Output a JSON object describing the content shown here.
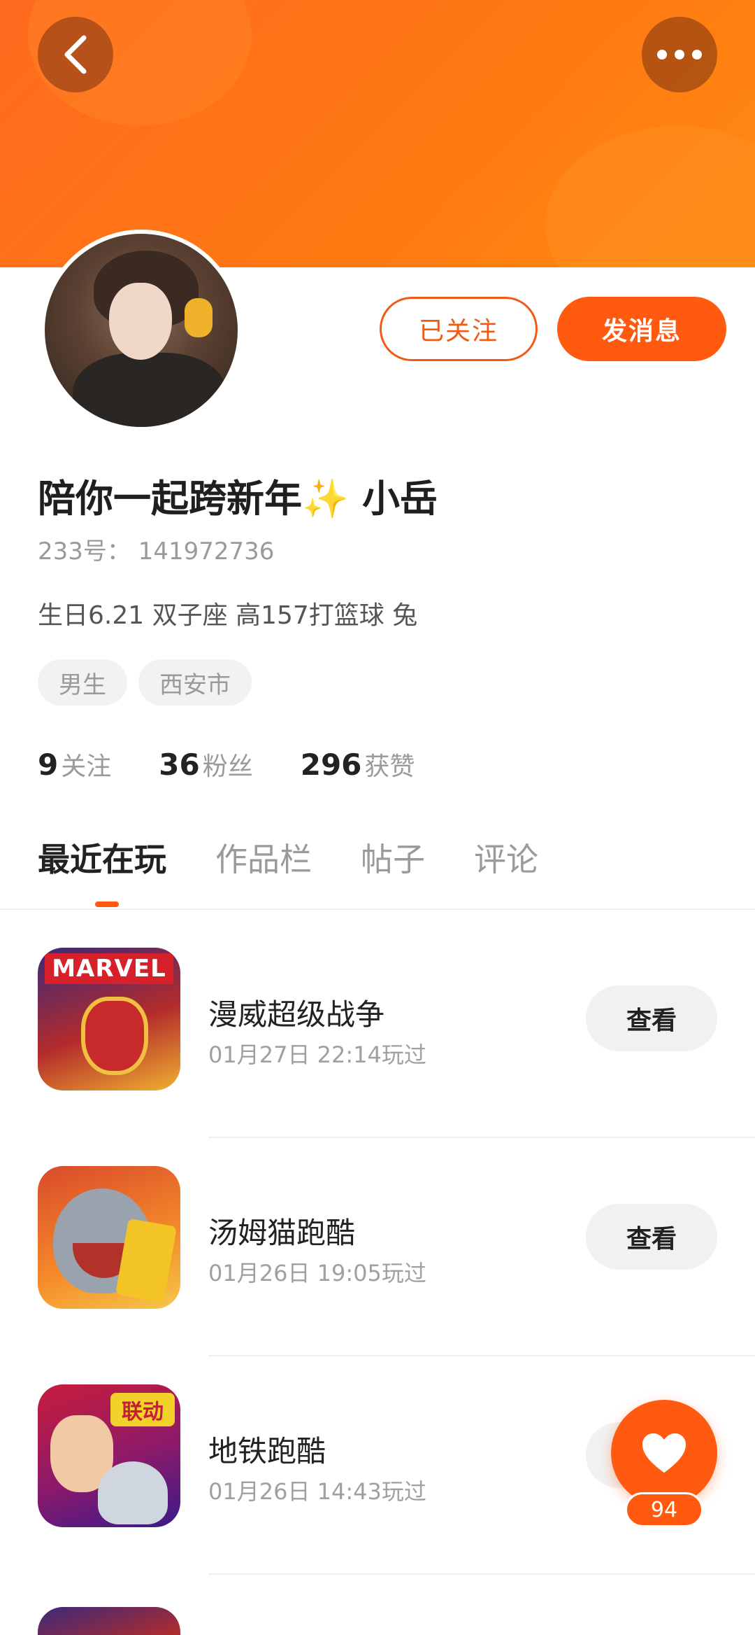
{
  "header": {
    "back_icon": "chevron-left-icon",
    "more_icon": "more-dots-icon",
    "accent": "#ff6a1f"
  },
  "profile": {
    "nickname": "陪你一起跨新年✨ 小岳",
    "uid_text": "233号： 141972736",
    "bio": "生日6.21 双子座 高157打篮球 兔",
    "tags": [
      "男生",
      "西安市"
    ],
    "follow_button": "已关注",
    "message_button": "发消息"
  },
  "stats": [
    {
      "num": "9",
      "label": "关注"
    },
    {
      "num": "36",
      "label": "粉丝"
    },
    {
      "num": "296",
      "label": "获赞"
    }
  ],
  "tabs": [
    "最近在玩",
    "作品栏",
    "帖子",
    "评论"
  ],
  "games": [
    {
      "title": "漫威超级战争",
      "time": "01月27日 22:14玩过",
      "button": "查看",
      "icon_text": "MARVEL"
    },
    {
      "title": "汤姆猫跑酷",
      "time": "01月26日 19:05玩过",
      "button": "查看"
    },
    {
      "title": "地铁跑酷",
      "time": "01月26日 14:43玩过",
      "button": "查看",
      "icon_text": "联动"
    }
  ],
  "like": {
    "count": "94",
    "icon": "heart-icon"
  }
}
